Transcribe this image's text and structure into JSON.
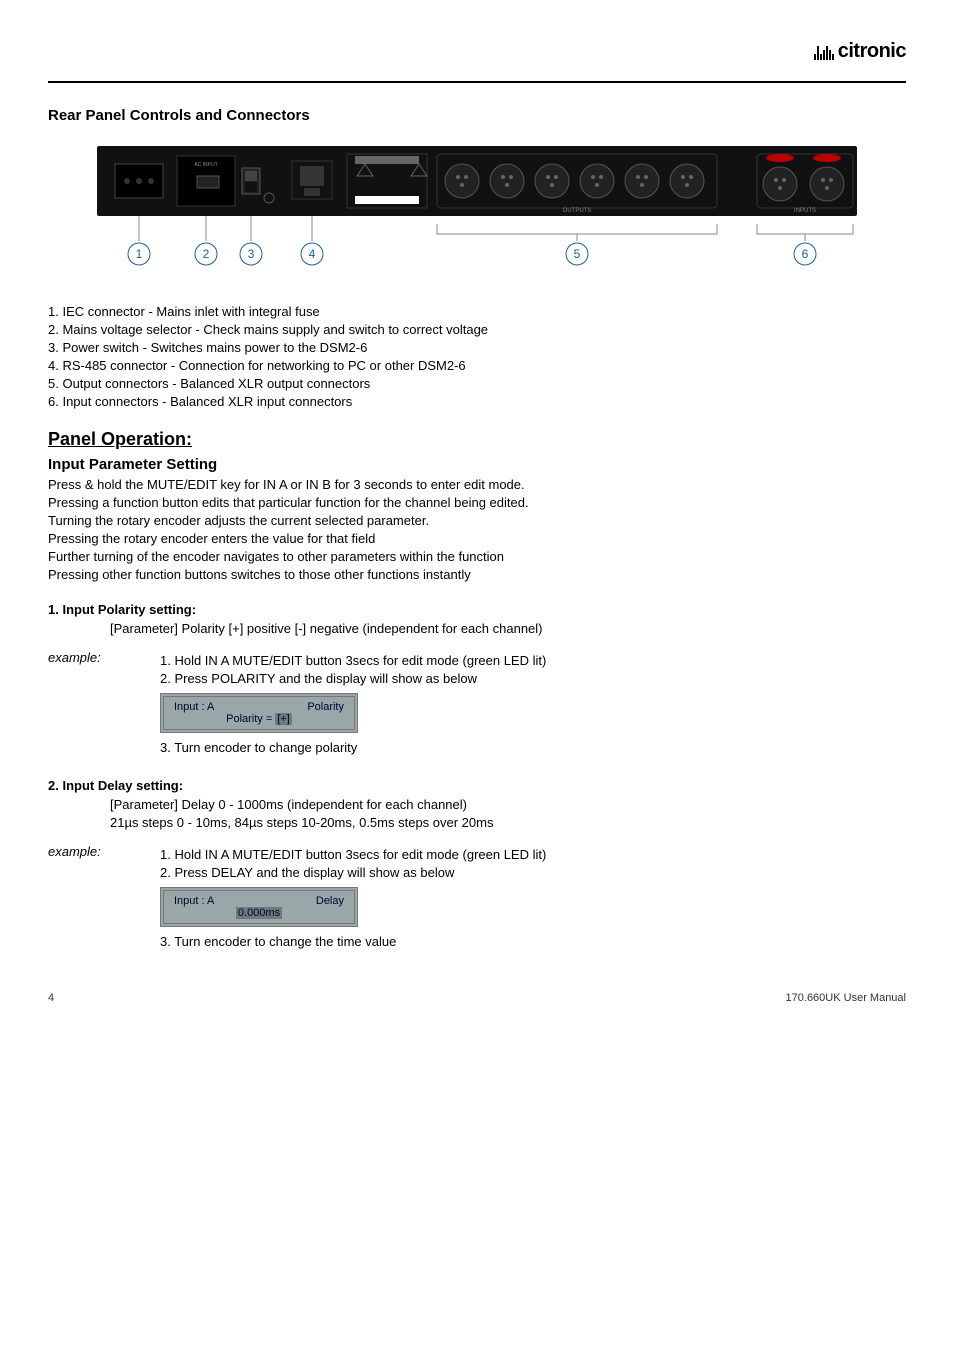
{
  "brand": "citronic",
  "section_title": "Rear Panel Controls and Connectors",
  "panel_labels": [
    "1",
    "2",
    "3",
    "4",
    "5",
    "6"
  ],
  "panel_items": [
    "1. IEC connector - Mains inlet with integral fuse",
    "2. Mains voltage selector - Check mains supply and switch to correct voltage",
    "3. Power switch - Switches mains power to the DSM2-6",
    "4. RS-485 connector - Connection for networking to PC or other DSM2-6",
    "5. Output connectors - Balanced XLR output connectors",
    "6. Input connectors - Balanced XLR input connectors"
  ],
  "panel_op_heading": "Panel Operation:",
  "input_param_heading": "Input Parameter Setting",
  "intro_paras": [
    "Press & hold the MUTE/EDIT key for IN A or IN B for 3 seconds to enter edit mode.",
    "Pressing a function button edits that particular function for the channel being edited.",
    "Turning the rotary encoder adjusts the current selected parameter.",
    "Pressing the rotary encoder enters the value for that field",
    "Further turning of the encoder navigates to other parameters within the function",
    "Pressing other function buttons switches to those other functions instantly"
  ],
  "polarity": {
    "heading": "1. Input Polarity setting:",
    "param": "[Parameter] Polarity [+] positive [-] negative (independent for each channel)",
    "example_label": "example:",
    "steps_a": [
      "1. Hold IN A MUTE/EDIT button 3secs for edit mode (green LED lit)",
      "2. Press POLARITY and the display will show as below"
    ],
    "lcd": {
      "left": "Input : A",
      "right": "Polarity",
      "line2_prefix": "Polarity = ",
      "line2_box": "[+]"
    },
    "steps_b": "3. Turn encoder to change polarity"
  },
  "delay": {
    "heading": "2. Input Delay setting:",
    "param1": "[Parameter] Delay 0 - 1000ms (independent for each channel)",
    "param2": "21µs steps 0 - 10ms, 84µs steps 10-20ms, 0.5ms steps over 20ms",
    "example_label": "example:",
    "steps_a": [
      "1. Hold IN A MUTE/EDIT button 3secs for edit mode (green LED lit)",
      "2. Press DELAY and the display will show as below"
    ],
    "lcd": {
      "left": "Input : A",
      "right": "Delay",
      "line2_box": "0.000ms"
    },
    "steps_b": "3. Turn encoder to change the time value"
  },
  "footer": {
    "page": "4",
    "doc": "170.660UK User Manual"
  }
}
